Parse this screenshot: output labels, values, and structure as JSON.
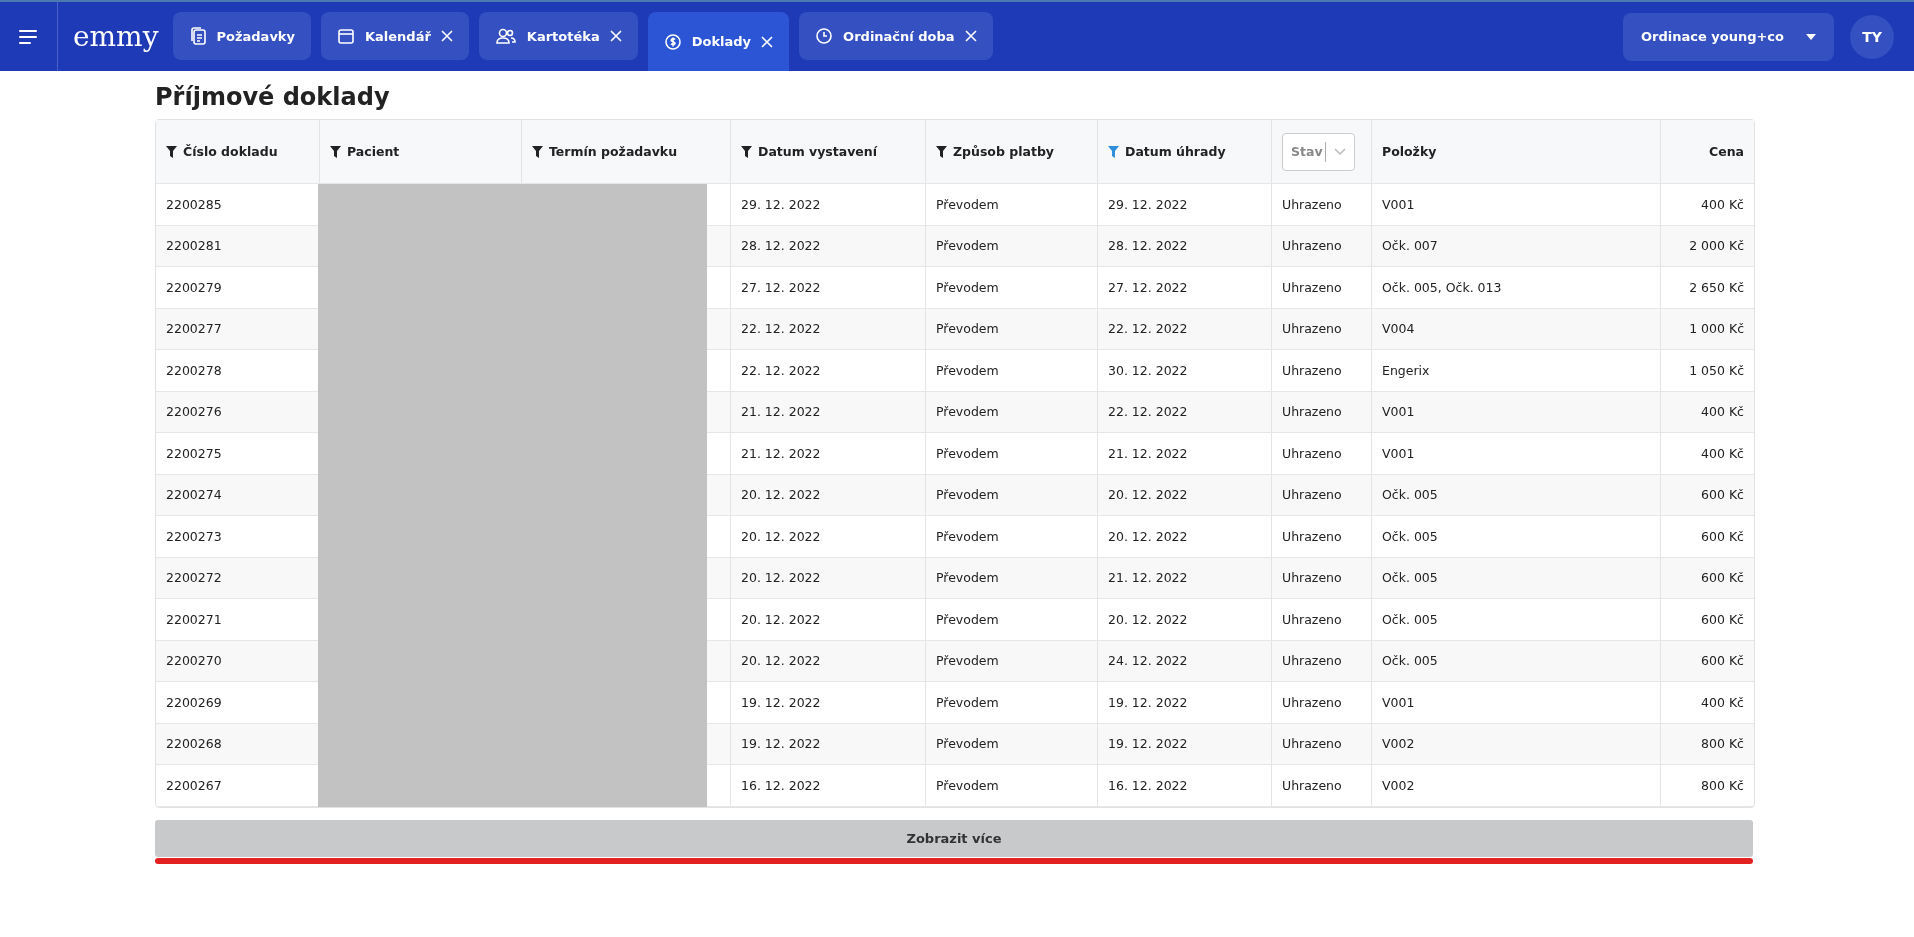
{
  "topbar": {
    "logo": "emmy",
    "tabs": [
      {
        "label": "Požadavky",
        "closable": false,
        "selected": false
      },
      {
        "label": "Kalendář",
        "closable": true,
        "selected": false
      },
      {
        "label": "Kartotéka",
        "closable": true,
        "selected": false
      },
      {
        "label": "Doklady",
        "closable": true,
        "selected": true
      },
      {
        "label": "Ordinační doba",
        "closable": true,
        "selected": false
      }
    ],
    "clinic": "Ordinace young+co",
    "avatar": "TY"
  },
  "title": "Příjmové doklady",
  "table": {
    "columns": [
      {
        "label": "Číslo dokladu",
        "kind": "filter",
        "filter_active": false
      },
      {
        "label": "Pacient",
        "kind": "filter",
        "filter_active": false
      },
      {
        "label": "Termín požadavku",
        "kind": "filter",
        "filter_active": false
      },
      {
        "label": "Datum vystavení",
        "kind": "filter",
        "filter_active": false
      },
      {
        "label": "Způsob platby",
        "kind": "filter",
        "filter_active": false
      },
      {
        "label": "Datum úhrady",
        "kind": "filter",
        "filter_active": true
      },
      {
        "placeholder": "Stav",
        "kind": "select"
      },
      {
        "label": "Položky",
        "kind": "plain"
      },
      {
        "label": "Cena",
        "kind": "plain"
      }
    ],
    "rows": [
      [
        "2200285",
        "",
        "",
        "29. 12. 2022",
        "Převodem",
        "29. 12. 2022",
        "Uhrazeno",
        "V001",
        "400 Kč"
      ],
      [
        "2200281",
        "",
        "",
        "28. 12. 2022",
        "Převodem",
        "28. 12. 2022",
        "Uhrazeno",
        "Očk. 007",
        "2 000 Kč"
      ],
      [
        "2200279",
        "",
        "",
        "27. 12. 2022",
        "Převodem",
        "27. 12. 2022",
        "Uhrazeno",
        "Očk. 005, Očk. 013",
        "2 650 Kč"
      ],
      [
        "2200277",
        "",
        "",
        "22. 12. 2022",
        "Převodem",
        "22. 12. 2022",
        "Uhrazeno",
        "V004",
        "1 000 Kč"
      ],
      [
        "2200278",
        "",
        "",
        "22. 12. 2022",
        "Převodem",
        "30. 12. 2022",
        "Uhrazeno",
        "Engerix",
        "1 050 Kč"
      ],
      [
        "2200276",
        "",
        "",
        "21. 12. 2022",
        "Převodem",
        "22. 12. 2022",
        "Uhrazeno",
        "V001",
        "400 Kč"
      ],
      [
        "2200275",
        "",
        "",
        "21. 12. 2022",
        "Převodem",
        "21. 12. 2022",
        "Uhrazeno",
        "V001",
        "400 Kč"
      ],
      [
        "2200274",
        "",
        "",
        "20. 12. 2022",
        "Převodem",
        "20. 12. 2022",
        "Uhrazeno",
        "Očk. 005",
        "600 Kč"
      ],
      [
        "2200273",
        "",
        "",
        "20. 12. 2022",
        "Převodem",
        "20. 12. 2022",
        "Uhrazeno",
        "Očk. 005",
        "600 Kč"
      ],
      [
        "2200272",
        "",
        "",
        "20. 12. 2022",
        "Převodem",
        "21. 12. 2022",
        "Uhrazeno",
        "Očk. 005",
        "600 Kč"
      ],
      [
        "2200271",
        "",
        "",
        "20. 12. 2022",
        "Převodem",
        "20. 12. 2022",
        "Uhrazeno",
        "Očk. 005",
        "600 Kč"
      ],
      [
        "2200270",
        "",
        "",
        "20. 12. 2022",
        "Převodem",
        "24. 12. 2022",
        "Uhrazeno",
        "Očk. 005",
        "600 Kč"
      ],
      [
        "2200269",
        "",
        "",
        "19. 12. 2022",
        "Převodem",
        "19. 12. 2022",
        "Uhrazeno",
        "V001",
        "400 Kč"
      ],
      [
        "2200268",
        "",
        "",
        "19. 12. 2022",
        "Převodem",
        "19. 12. 2022",
        "Uhrazeno",
        "V002",
        "800 Kč"
      ],
      [
        "2200267",
        "",
        "",
        "16. 12. 2022",
        "Převodem",
        "16. 12. 2022",
        "Uhrazeno",
        "V002",
        "800 Kč"
      ]
    ]
  },
  "more_button": "Zobrazit více"
}
